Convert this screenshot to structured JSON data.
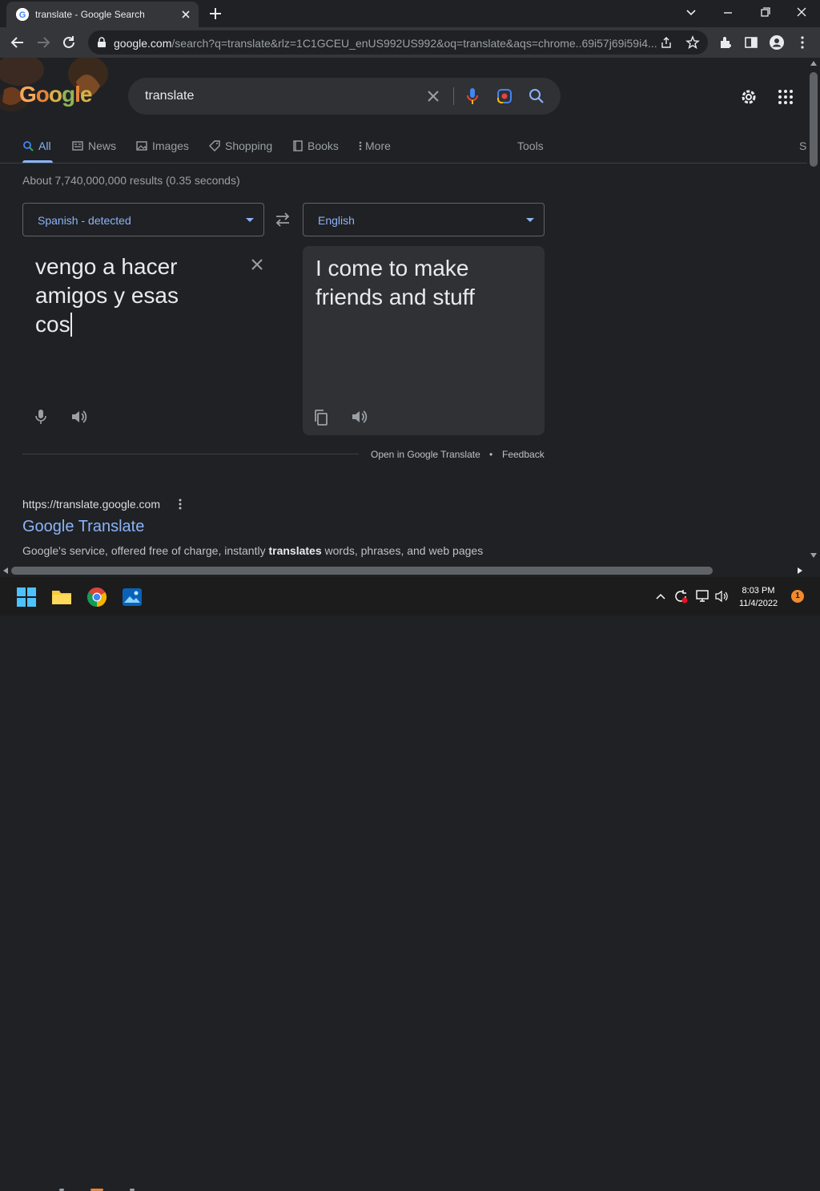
{
  "browser": {
    "tab_title": "translate - Google Search",
    "url_host": "google.com",
    "url_rest": "/search?q=translate&rlz=1C1GCEU_enUS992US992&oq=translate&aqs=chrome..69i57j69i59i4..."
  },
  "search": {
    "logo": "Google",
    "query": "translate",
    "tabs": [
      {
        "label": "All",
        "icon": "search-icon"
      },
      {
        "label": "News",
        "icon": "news-icon"
      },
      {
        "label": "Images",
        "icon": "image-icon"
      },
      {
        "label": "Shopping",
        "icon": "tag-icon"
      },
      {
        "label": "Books",
        "icon": "book-icon"
      },
      {
        "label": "More",
        "icon": "dots-vertical-icon"
      }
    ],
    "tools_label": "Tools",
    "cut_label": "S",
    "stats": "About 7,740,000,000 results (0.35 seconds)"
  },
  "translator": {
    "source_lang": "Spanish - detected",
    "target_lang": "English",
    "source_text": "vengo a hacer\namigos y esas\ncos",
    "target_text": "I come to make\nfriends and stuff",
    "open_link": "Open in Google Translate",
    "separator": "•",
    "feedback": "Feedback"
  },
  "result": {
    "url": "https://translate.google.com",
    "title": "Google Translate",
    "snippet_pre": "Google's service, offered free of charge, instantly ",
    "snippet_bold": "translates",
    "snippet_post": " words, phrases, and web pages"
  },
  "taskbar": {
    "time": "8:03 PM",
    "date": "11/4/2022",
    "notification_count": "1"
  },
  "colors": {
    "background": "#202124",
    "accent": "#8ab4f8",
    "surface": "#303134"
  }
}
